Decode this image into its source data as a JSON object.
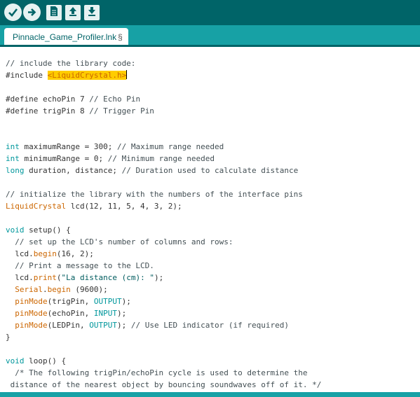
{
  "toolbar": {
    "buttons": [
      {
        "icon": "check-icon",
        "label": "Verify"
      },
      {
        "icon": "arrow-right-icon",
        "label": "Upload"
      },
      {
        "icon": "new-file-icon",
        "label": "New"
      },
      {
        "icon": "open-icon",
        "label": "Open"
      },
      {
        "icon": "save-icon",
        "label": "Save"
      }
    ]
  },
  "tab": {
    "title": "Pinnacle_Game_Profiler.lnk",
    "mark": "§"
  },
  "colors": {
    "toolbar": "#006468",
    "tabbar": "#17a1a5",
    "keyword": "#00979c",
    "function": "#cc6600",
    "highlight": "#ffcc00"
  },
  "code_lines": [
    [
      {
        "t": "// include the library code:",
        "c": "cm"
      }
    ],
    [
      {
        "t": "#include ",
        "c": ""
      },
      {
        "t": "<LiquidCrystal.h>",
        "c": "hl"
      }
    ],
    [],
    [
      {
        "t": "#define echoPin 7 ",
        "c": ""
      },
      {
        "t": "// Echo Pin",
        "c": "cm"
      }
    ],
    [
      {
        "t": "#define trigPin 8 ",
        "c": ""
      },
      {
        "t": "// Trigger Pin",
        "c": "cm"
      }
    ],
    [],
    [],
    [
      {
        "t": "int",
        "c": "kw"
      },
      {
        "t": " maximumRange = 300; ",
        "c": ""
      },
      {
        "t": "// Maximum range needed",
        "c": "cm"
      }
    ],
    [
      {
        "t": "int",
        "c": "kw"
      },
      {
        "t": " minimumRange = 0; ",
        "c": ""
      },
      {
        "t": "// Minimum range needed",
        "c": "cm"
      }
    ],
    [
      {
        "t": "long",
        "c": "kw"
      },
      {
        "t": " duration, distance; ",
        "c": ""
      },
      {
        "t": "// Duration used to calculate distance",
        "c": "cm"
      }
    ],
    [],
    [
      {
        "t": "// initialize the library with the numbers of the interface pins",
        "c": "cm"
      }
    ],
    [
      {
        "t": "LiquidCrystal",
        "c": "kw2"
      },
      {
        "t": " lcd(12, 11, 5, 4, 3, 2);",
        "c": ""
      }
    ],
    [],
    [
      {
        "t": "void",
        "c": "kw"
      },
      {
        "t": " setup() {",
        "c": ""
      }
    ],
    [
      {
        "t": "  // set up the LCD's number of columns and rows:",
        "c": "cm"
      }
    ],
    [
      {
        "t": "  lcd.",
        "c": ""
      },
      {
        "t": "begin",
        "c": "kw2"
      },
      {
        "t": "(16, 2);",
        "c": ""
      }
    ],
    [
      {
        "t": "  // Print a message to the LCD.",
        "c": "cm"
      }
    ],
    [
      {
        "t": "  lcd.",
        "c": ""
      },
      {
        "t": "print",
        "c": "kw2"
      },
      {
        "t": "(",
        "c": ""
      },
      {
        "t": "\"La distance (cm): \"",
        "c": "str"
      },
      {
        "t": ");",
        "c": ""
      }
    ],
    [
      {
        "t": "  ",
        "c": ""
      },
      {
        "t": "Serial",
        "c": "kw2"
      },
      {
        "t": ".",
        "c": ""
      },
      {
        "t": "begin",
        "c": "kw2"
      },
      {
        "t": " (9600);",
        "c": ""
      }
    ],
    [
      {
        "t": "  ",
        "c": ""
      },
      {
        "t": "pinMode",
        "c": "kw2"
      },
      {
        "t": "(trigPin, ",
        "c": ""
      },
      {
        "t": "OUTPUT",
        "c": "kw"
      },
      {
        "t": ");",
        "c": ""
      }
    ],
    [
      {
        "t": "  ",
        "c": ""
      },
      {
        "t": "pinMode",
        "c": "kw2"
      },
      {
        "t": "(echoPin, ",
        "c": ""
      },
      {
        "t": "INPUT",
        "c": "kw"
      },
      {
        "t": ");",
        "c": ""
      }
    ],
    [
      {
        "t": "  ",
        "c": ""
      },
      {
        "t": "pinMode",
        "c": "kw2"
      },
      {
        "t": "(LEDPin, ",
        "c": ""
      },
      {
        "t": "OUTPUT",
        "c": "kw"
      },
      {
        "t": "); ",
        "c": ""
      },
      {
        "t": "// Use LED indicator (if required)",
        "c": "cm"
      }
    ],
    [
      {
        "t": "}",
        "c": ""
      }
    ],
    [],
    [
      {
        "t": "void",
        "c": "kw"
      },
      {
        "t": " loop() {",
        "c": ""
      }
    ],
    [
      {
        "t": "  /* The following trigPin/echoPin cycle is used to determine the",
        "c": "cm"
      }
    ],
    [
      {
        "t": " distance of the nearest object by bouncing soundwaves off of it. */",
        "c": "cm"
      }
    ]
  ]
}
